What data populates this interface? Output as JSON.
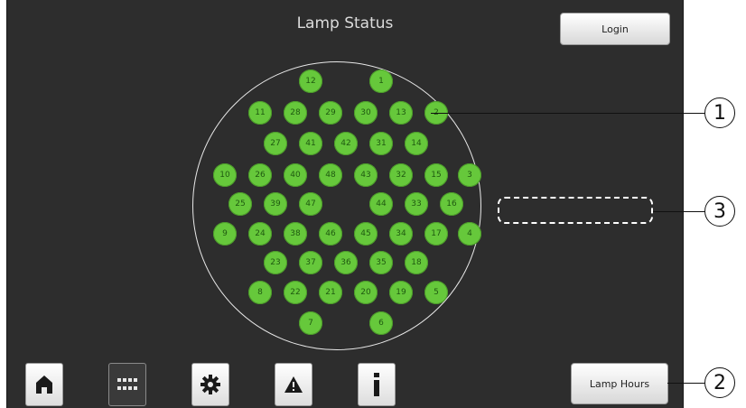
{
  "header": {
    "title": "Lamp Status",
    "login_label": "Login"
  },
  "footer": {
    "lamp_hours_label": "Lamp Hours"
  },
  "status_colors": {
    "lamp_ok": "#66c83b",
    "background": "#2d2d2d"
  },
  "lamps": [
    "12",
    "1",
    "11",
    "28",
    "29",
    "30",
    "13",
    "2",
    "27",
    "41",
    "42",
    "31",
    "14",
    "10",
    "26",
    "40",
    "48",
    "43",
    "32",
    "15",
    "3",
    "25",
    "39",
    "47",
    "44",
    "33",
    "16",
    "9",
    "24",
    "38",
    "46",
    "45",
    "34",
    "17",
    "4",
    "23",
    "37",
    "36",
    "35",
    "18",
    "8",
    "22",
    "21",
    "20",
    "19",
    "5",
    "7",
    "6"
  ],
  "nav": [
    {
      "name": "home-icon"
    },
    {
      "name": "lamp-grid-icon"
    },
    {
      "name": "gear-icon"
    },
    {
      "name": "warning-icon"
    },
    {
      "name": "info-icon"
    }
  ],
  "callouts": [
    "1",
    "2",
    "3"
  ]
}
